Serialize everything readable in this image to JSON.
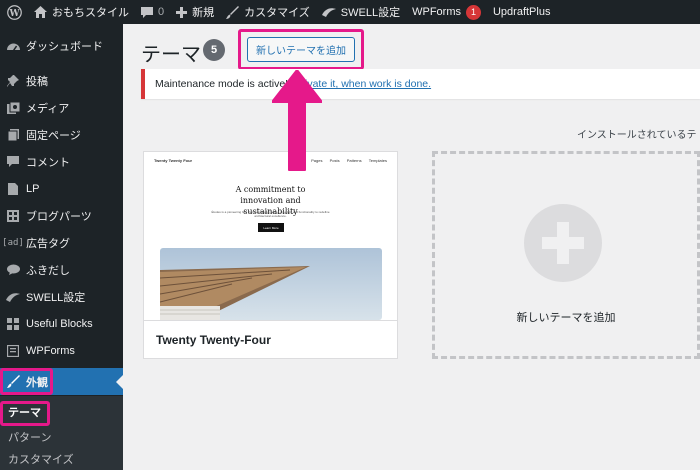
{
  "admin_bar": {
    "site_name": "おもちスタイル",
    "comments_count": "0",
    "new_label": "新規",
    "customize_label": "カスタマイズ",
    "swell_label": "SWELL設定",
    "wpforms_label": "WPForms",
    "wpforms_badge": "1",
    "updraft_label": "UpdraftPlus"
  },
  "sidebar": {
    "items": [
      {
        "label": "ダッシュボード",
        "icon": "dashboard-icon"
      },
      {
        "label": "投稿",
        "icon": "pin-icon"
      },
      {
        "label": "メディア",
        "icon": "media-icon"
      },
      {
        "label": "固定ページ",
        "icon": "page-icon"
      },
      {
        "label": "コメント",
        "icon": "comment-icon"
      },
      {
        "label": "LP",
        "icon": "document-icon"
      },
      {
        "label": "ブログパーツ",
        "icon": "grid-icon"
      },
      {
        "label": "広告タグ",
        "icon": "ad-icon"
      },
      {
        "label": "ふきだし",
        "icon": "speech-bubble-icon"
      },
      {
        "label": "SWELL設定",
        "icon": "swell-icon"
      },
      {
        "label": "Useful Blocks",
        "icon": "blocks-icon"
      },
      {
        "label": "WPForms",
        "icon": "forms-icon"
      },
      {
        "label": "外観",
        "icon": "brush-icon"
      }
    ],
    "submenu": [
      "テーマ",
      "パターン",
      "カスタマイズ"
    ]
  },
  "main": {
    "title": "テーマ",
    "count": "5",
    "add_button": "新しいテーマを追加",
    "notice_prefix": "Maintenance mode is active!",
    "notice_link": "activate it, when work is done.",
    "installed_text": "インストールされているテ"
  },
  "theme": {
    "name": "Twenty Twenty-Four",
    "screenshot": {
      "site_title": "Twenty Twenty Four",
      "nav": [
        "Pages",
        "Pages",
        "Posts",
        "Patterns",
        "Templates"
      ],
      "headline": "A commitment to innovation and sustainability",
      "body": "Études is a pioneering firm that seamlessly merges creativity and functionality to redefine architectural excellence.",
      "button": "Learn More"
    }
  },
  "add_card": {
    "label": "新しいテーマを追加"
  },
  "colors": {
    "admin_dark": "#1d2327",
    "accent_blue": "#2271b1",
    "highlight_pink": "#e5198a",
    "notice_red": "#d63638"
  }
}
